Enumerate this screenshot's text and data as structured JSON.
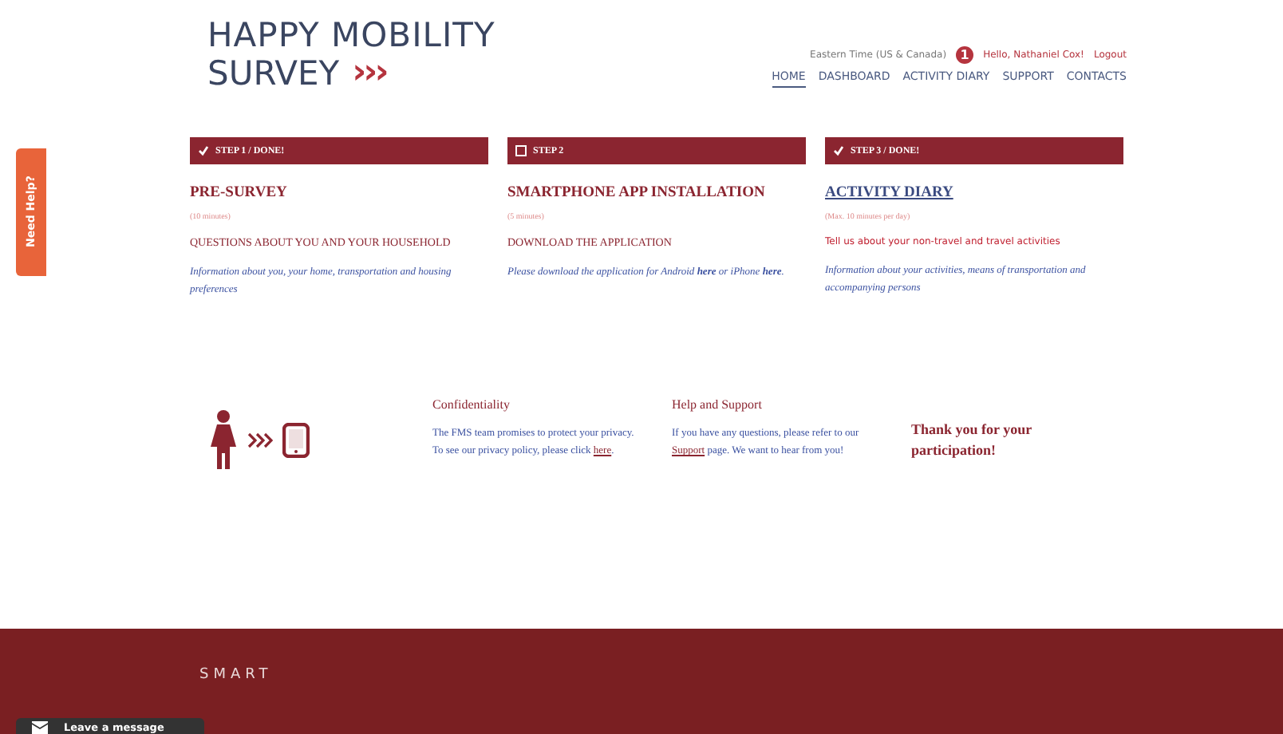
{
  "logo": {
    "line1": "HAPPY MOBILITY",
    "line2": "SURVEY",
    "chevrons": "›››"
  },
  "topbar": {
    "timezone": "Eastern Time (US & Canada)",
    "badge": "1",
    "greeting": "Hello, Nathaniel Cox!",
    "logout": "Logout"
  },
  "nav": [
    {
      "label": "HOME",
      "selected": true
    },
    {
      "label": "DASHBOARD",
      "selected": false
    },
    {
      "label": "ACTIVITY DIARY",
      "selected": false
    },
    {
      "label": "SUPPORT",
      "selected": false
    },
    {
      "label": "CONTACTS",
      "selected": false
    }
  ],
  "steps": [
    {
      "label": "STEP 1 / DONE!",
      "done": true,
      "title": "PRE-SURVEY",
      "duration": "(10 minutes)",
      "heading": "QUESTIONS ABOUT YOU AND YOUR HOUSEHOLD",
      "text": "Information about you, your home, transportation and housing preferences"
    },
    {
      "label": "STEP 2",
      "done": false,
      "title": "SMARTPHONE APP INSTALLATION",
      "duration": "(5 minutes)",
      "heading": "DOWNLOAD THE APPLICATION",
      "text": "Please download the application for Android **here** or iPhone **here**."
    },
    {
      "label": "STEP 3 / DONE!",
      "done": true,
      "title": "ACTIVITY DIARY",
      "duration": "(Max. 10 minutes per day)",
      "heading": "Tell us about your non-travel and travel activities",
      "text": "Information about your activities, means of transportation and accompanying persons"
    }
  ],
  "info": [
    {
      "title": "Confidentiality",
      "text": "The FMS team promises to protect your privacy. To see our privacy policy, please click **here**."
    },
    {
      "title": "Help and Support",
      "text": "If you have any questions, please refer to our **Support** page. We want to hear from you!"
    }
  ],
  "thanks": "Thank you for your participation!",
  "help_tab": "Need Help?",
  "footer": {
    "brand": "SMART"
  },
  "chat": {
    "label": "Leave a message"
  }
}
